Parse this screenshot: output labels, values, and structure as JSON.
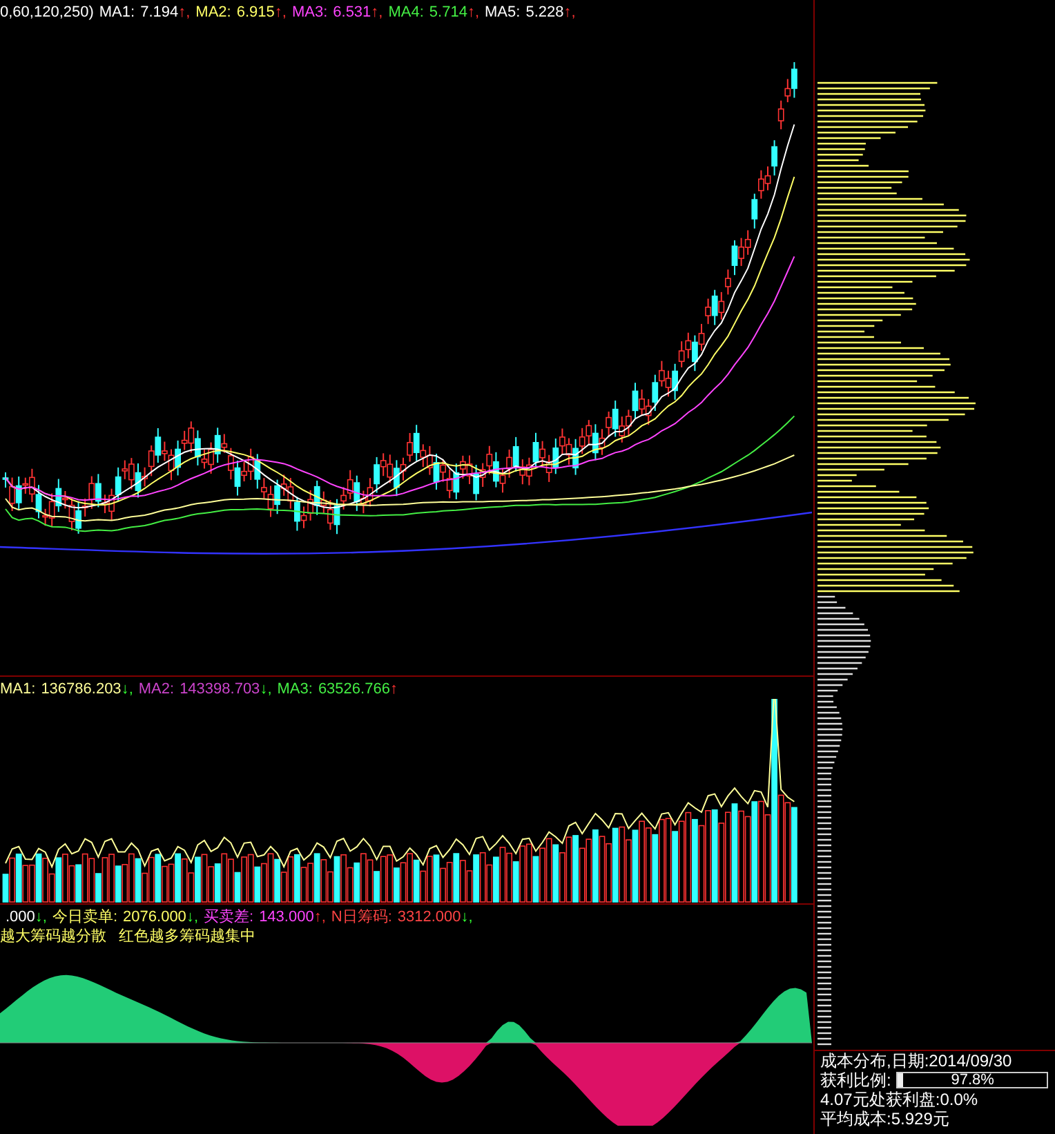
{
  "main_chart": {
    "legend_prefix": "0,60,120,250)",
    "indicators": [
      {
        "label": "MA1:",
        "value": "7.194",
        "arrow": "↑,",
        "kind": "up",
        "color": "#ffffff"
      },
      {
        "label": "MA2:",
        "value": "6.915",
        "arrow": "↑,",
        "kind": "up",
        "color": "#ffff66"
      },
      {
        "label": "MA3:",
        "value": "6.531",
        "arrow": "↑,",
        "kind": "up",
        "color": "#ff44ff"
      },
      {
        "label": "MA4:",
        "value": "5.714",
        "arrow": "↑,",
        "kind": "up",
        "color": "#44ee44"
      },
      {
        "label": "MA5:",
        "value": "5.228",
        "arrow": "↑,",
        "kind": "up",
        "color": "#ffffff"
      }
    ]
  },
  "volume_chart": {
    "indicators": [
      {
        "label": "MA1:",
        "value": "136786.203",
        "arrow": "↓,",
        "kind": "down",
        "color": "#ffff99"
      },
      {
        "label": "MA2:",
        "value": "143398.703",
        "arrow": "↓,",
        "kind": "down",
        "color": "#cc44cc"
      },
      {
        "label": "MA3:",
        "value": "63526.766",
        "arrow": "↑",
        "kind": "up",
        "color": "#44ee44"
      }
    ]
  },
  "indicator_chart": {
    "indicators": [
      {
        "value": ".000",
        "arrow": "↓,",
        "kind": "down",
        "color": "#ffffff"
      },
      {
        "label": "今日卖单:",
        "value": "2076.000",
        "arrow": "↓,",
        "kind": "down",
        "color": "#ffff66"
      },
      {
        "label": "买卖差:",
        "value": "143.000",
        "arrow": "↑,",
        "kind": "up",
        "color": "#ff44ff"
      },
      {
        "label": "N日筹码:",
        "value": "3312.000",
        "arrow": "↓,",
        "kind": "down",
        "color": "#ff4444"
      }
    ],
    "note": "越大筹码越分散   红色越多筹码越集中"
  },
  "cost_distribution": {
    "title": "成本分布,日期:2014/09/30",
    "profit_label": "获利比例:",
    "profit_value": "97.8%",
    "level": 0.03,
    "profit_at_price": "4.07元处获利盘:0.0%",
    "average_cost": "平均成本:5.929元"
  }
}
